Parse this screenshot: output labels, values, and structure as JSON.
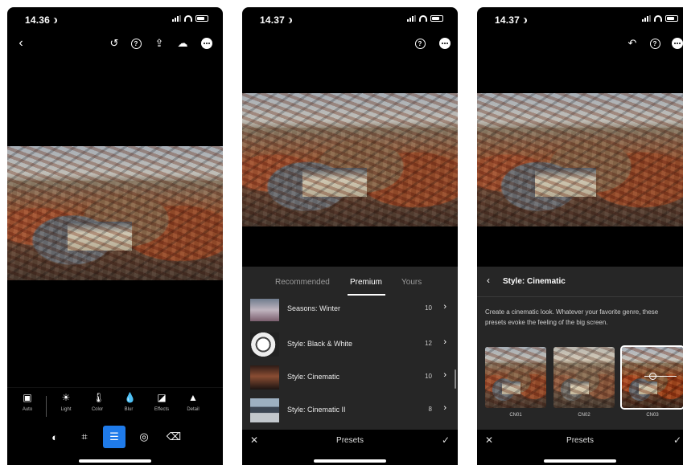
{
  "screens": [
    {
      "time": "14.36",
      "tools": [
        {
          "label": "Auto",
          "icon": "auto-icon"
        },
        {
          "label": "Light",
          "icon": "sun-icon"
        },
        {
          "label": "Color",
          "icon": "thermometer-icon"
        },
        {
          "label": "Blur",
          "icon": "drop-icon"
        },
        {
          "label": "Effects",
          "icon": "effects-icon"
        },
        {
          "label": "Detail",
          "icon": "triangle-icon"
        }
      ],
      "modes": [
        "presets-icon",
        "crop-icon",
        "adjust-icon",
        "mask-icon",
        "eraser-icon"
      ]
    },
    {
      "time": "14.37",
      "tabs": [
        "Recommended",
        "Premium",
        "Yours"
      ],
      "active_tab": "Premium",
      "presets": [
        {
          "name": "Seasons: Winter",
          "count": "10"
        },
        {
          "name": "Style: Black & White",
          "count": "12"
        },
        {
          "name": "Style: Cinematic",
          "count": "10"
        },
        {
          "name": "Style: Cinematic II",
          "count": "8"
        }
      ],
      "bottom_title": "Presets"
    },
    {
      "time": "14.37",
      "group_title": "Style: Cinematic",
      "description": "Create a cinematic look. Whatever your favorite genre, these presets evoke the feeling of the big screen.",
      "preset_thumbs": [
        "CN01",
        "CN02",
        "CN03"
      ],
      "selected_preset": "CN03",
      "bottom_title": "Presets"
    }
  ]
}
